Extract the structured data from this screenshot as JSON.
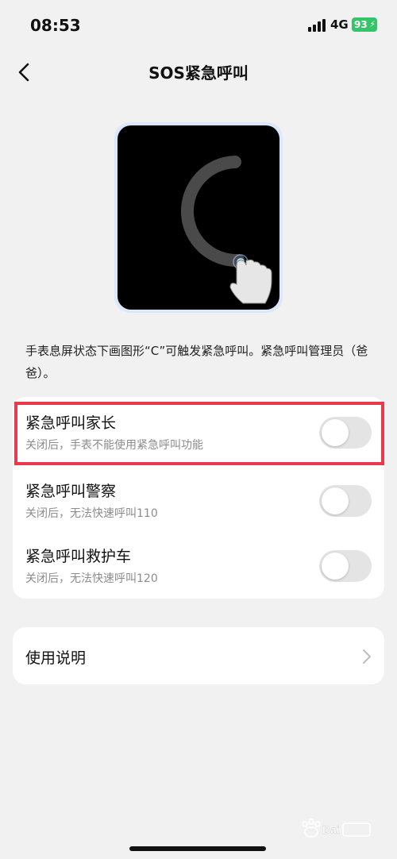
{
  "status_bar": {
    "time": "08:53",
    "network": "4G",
    "battery": "93"
  },
  "nav": {
    "title": "SOS紧急呼叫"
  },
  "description": "手表息屏状态下画图形“C”可触发紧急呼叫。紧急呼叫管理员（爸爸）。",
  "settings": [
    {
      "title": "紧急呼叫家长",
      "subtitle": "关闭后，手表不能使用紧急呼叫功能",
      "enabled": false
    },
    {
      "title": "紧急呼叫警察",
      "subtitle": "关闭后，无法快速呼叫110",
      "enabled": false
    },
    {
      "title": "紧急呼叫救护车",
      "subtitle": "关闭后，无法快速呼叫120",
      "enabled": false
    }
  ],
  "help": {
    "label": "使用说明"
  },
  "colors": {
    "background": "#f1f1f1",
    "highlight": "#e83a4c",
    "battery": "#36c46b"
  }
}
